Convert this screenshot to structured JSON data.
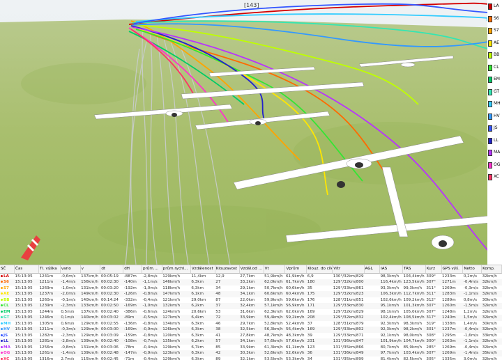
{
  "scene": {
    "top_label": "[143]"
  },
  "legend": [
    {
      "code": "LA",
      "color": "#d40000"
    },
    {
      "code": "S6",
      "color": "#ff6a00"
    },
    {
      "code": "S7",
      "color": "#ffa500"
    },
    {
      "code": "AE",
      "color": "#ffe600"
    },
    {
      "code": "BB",
      "color": "#bfff00"
    },
    {
      "code": "CL",
      "color": "#33e633"
    },
    {
      "code": "EM",
      "color": "#00cc66"
    },
    {
      "code": "GT",
      "color": "#33e6b3"
    },
    {
      "code": "MH",
      "color": "#33ccff"
    },
    {
      "code": "HV",
      "color": "#3399ff"
    },
    {
      "code": "JS",
      "color": "#3355ff"
    },
    {
      "code": "LL",
      "color": "#2222cc"
    },
    {
      "code": "MA",
      "color": "#b833ff"
    },
    {
      "code": "OG",
      "color": "#ff33cc"
    },
    {
      "code": "XC",
      "color": "#ff3366"
    }
  ],
  "table": {
    "columns": [
      "SČ",
      "Čas",
      "Tl. výška",
      "vario",
      "v",
      "dt",
      "dH",
      "prům....",
      "prům.rychl...",
      "Vzdálenost",
      "Klouzavost",
      "Vzdál.od ...",
      "Vt",
      "Vprům",
      "Klouz. do cíle",
      "Vítr",
      "AGL",
      "IAS",
      "TAS",
      "Kurz",
      "GPS výš.",
      "Netto",
      "Komp."
    ],
    "rows": [
      [
        "LA",
        "15:13:05",
        "1241m",
        "-0,6m/s",
        "137km/h",
        "00:05:19",
        "-887m",
        "-2,8m/s",
        "129km/h",
        "11,4km",
        "12,9",
        "27,7km",
        "51,9km/h",
        "61,9km/h",
        "6,9",
        "130°/32km/829m",
        "",
        "98,3km/h",
        "104,4km/h",
        "309°",
        "1233m",
        "0,2m/s",
        "32km/h"
      ],
      [
        "S6",
        "15:13:05",
        "1211m",
        "-1,4m/s",
        "156km/h",
        "00:02:30",
        "-140m",
        "-1,1m/s",
        "146km/h",
        "6,3km",
        "27",
        "33,2km",
        "62,0km/h",
        "61,7km/h",
        "180",
        "129°/32km/800m",
        "",
        "116,4km/h",
        "123,5km/h",
        "307°",
        "1271m",
        "-0,4m/s",
        "32km/h"
      ],
      [
        "S7",
        "15:13:05",
        "1269m",
        "-1,0m/s",
        "131km/h",
        "00:03:20",
        "-192m",
        "-1,0m/s",
        "118km/h",
        "6,3km",
        "34",
        "29,1km",
        "50,7km/h",
        "60,6km/h",
        "35",
        "129°/33km/861m",
        "",
        "93,3km/h",
        "99,3km/h",
        "311°",
        "1269m",
        "-0,3m/s",
        "32km/h"
      ],
      [
        "AE",
        "15:13:05",
        "1237m",
        "-2,0m/s",
        "149km/h",
        "00:02:30",
        "-126m",
        "-0,8m/s",
        "147km/h",
        "6,1km",
        "48",
        "34,1km",
        "60,6km/h",
        "60,4km/h",
        "175",
        "129°/32km/823m",
        "",
        "106,3km/h",
        "112,7km/h",
        "311°",
        "1283m",
        "-1,1m/s",
        "32km/h"
      ],
      [
        "BB",
        "15:13:05",
        "1260m",
        "-0,1m/s",
        "140km/h",
        "00:14:24",
        "-332m",
        "-0,4m/s",
        "121km/h",
        "29,0km",
        "87",
        "22,0km",
        "59,9km/h",
        "59,6km/h",
        "176",
        "128°/31km/851m",
        "",
        "102,6km/h",
        "109,2km/h",
        "312°",
        "1289m",
        "0,8m/s",
        "30km/h"
      ],
      [
        "CL",
        "15:13:05",
        "1239m",
        "-2,3m/s",
        "133km/h",
        "00:02:50",
        "-169m",
        "-1,0m/s",
        "132km/h",
        "6,2km",
        "37",
        "32,4km",
        "57,1km/h",
        "56,9km/h",
        "171",
        "129°/33km/830m",
        "",
        "95,1km/h",
        "101,3km/h",
        "307°",
        "1260m",
        "-1,5m/s",
        "32km/h"
      ],
      [
        "EM",
        "15:13:05",
        "1244m",
        "0,5m/s",
        "137km/h",
        "00:02:40",
        "-386m",
        "-0,6m/s",
        "124km/h",
        "20,6km",
        "53",
        "31,6km",
        "62,3km/h",
        "62,0km/h",
        "169",
        "129°/32km/829m",
        "",
        "98,1km/h",
        "105,0km/h",
        "307°",
        "1248m",
        "1,2m/s",
        "32km/h"
      ],
      [
        "GT",
        "15:13:05",
        "1246m",
        "0,1m/s",
        "140km/h",
        "00:03:02",
        "-89m",
        "-0,5m/s",
        "127km/h",
        "6,4km",
        "72",
        "33,9km",
        "59,4km/h",
        "59,2km/h",
        "208",
        "129°/32km/832m",
        "",
        "102,4km/h",
        "108,5km/h",
        "317°",
        "1240m",
        "1,5m/s",
        "32km/h"
      ],
      [
        "MH",
        "15:13:05",
        "1305m",
        "0,6m/s",
        "129km/h",
        "00:02:55",
        "-136m",
        "-0,8m/s",
        "134km/h",
        "6,3km",
        "46",
        "29,7km",
        "52,8km/h",
        "52,4km/h",
        "37",
        "128°/31km/879m",
        "",
        "92,3km/h",
        "98,3km/h",
        "319°",
        "1338m",
        "1,4m/s",
        "30km/h"
      ],
      [
        "HV",
        "15:13:05",
        "1211m",
        "-0,3m/s",
        "129km/h",
        "00:03:00",
        "-169m",
        "-0,9m/s",
        "126km/h",
        "6,3km",
        "38",
        "32,5km",
        "56,3km/h",
        "56,4km/h",
        "169",
        "129°/33km/802m",
        "",
        "92,3km/h",
        "98,2km/h",
        "301°",
        "1237m",
        "-0,4m/s",
        "32km/h"
      ],
      [
        "JS",
        "15:13:05",
        "1282m",
        "-2,3m/s",
        "129km/h",
        "00:03:09",
        "-159m",
        "-0,8m/s",
        "120km/h",
        "6,3km",
        "41",
        "27,8km",
        "48,7km/h",
        "48,3km/h",
        "39",
        "129°/33km/871m",
        "",
        "92,1km/h",
        "98,0km/h",
        "308°",
        "1295m",
        "-1,6m/s",
        "33km/h"
      ],
      [
        "LL",
        "15:13:05",
        "1281m",
        "-2,8m/s",
        "139km/h",
        "00:02:40",
        "-108m",
        "-0,7m/s",
        "135km/h",
        "6,2km",
        "57",
        "34,1km",
        "57,6km/h",
        "57,6km/h",
        "231",
        "131°/36km/847m",
        "",
        "101,9km/h",
        "104,7km/h",
        "300°",
        "1263m",
        "-1,1m/s",
        "32km/h"
      ],
      [
        "MA",
        "15:13:05",
        "1256m",
        "-0,8m/s",
        "131km/h",
        "00:03:06",
        "-78m",
        "-0,4m/s",
        "129km/h",
        "6,7km",
        "85",
        "33,9km",
        "61,3km/h",
        "61,1km/h",
        "123",
        "131°/35km/866m",
        "",
        "80,7km/h",
        "85,9km/h",
        "285°",
        "1269m",
        "-0,4m/s",
        "32km/h"
      ],
      [
        "OG",
        "15:13:05",
        "1261m",
        "-1,4m/s",
        "139km/h",
        "00:02:48",
        "-147m",
        "-0,9m/s",
        "123km/h",
        "6,3km",
        "42",
        "30,3km",
        "52,6km/h",
        "52,6km/h",
        "36",
        "131°/36km/849m",
        "",
        "97,7km/h",
        "103,4km/h",
        "307°",
        "1269m",
        "-1,4m/s",
        "35km/h"
      ],
      [
        "XC",
        "15:13:05",
        "1316m",
        "2,7m/s",
        "115km/h",
        "00:02:45",
        "-71m",
        "-0,4m/s",
        "129km/h",
        "6,3km",
        "89",
        "32,1km",
        "53,5km/h",
        "53,3km/h",
        "34",
        "131°/35km/899m",
        "",
        "81,4km/h",
        "82,5km/h",
        "305°",
        "1335m",
        "3,0m/s",
        "32km/h"
      ]
    ]
  }
}
